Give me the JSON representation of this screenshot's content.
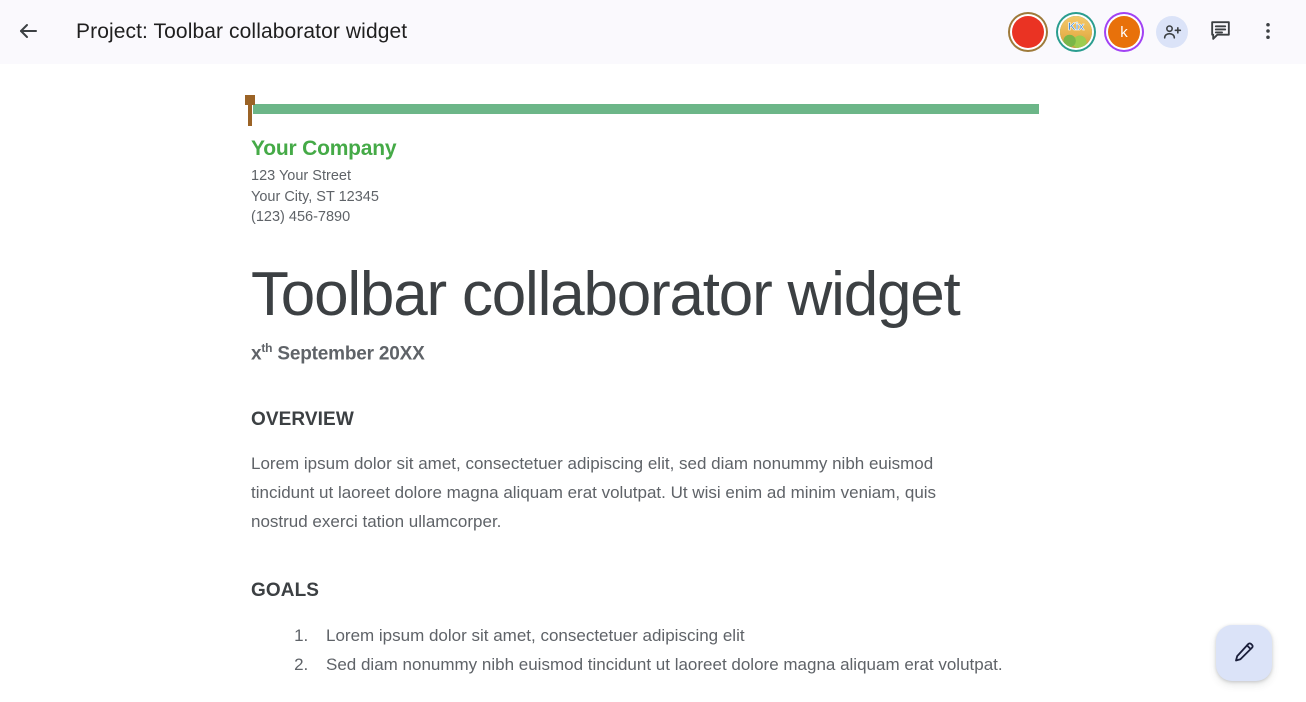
{
  "appbar": {
    "back_icon": "arrow-left-icon",
    "title": "Project: Toolbar collaborator widget",
    "collaborators": [
      {
        "name": "collaborator-red",
        "initial": "",
        "fill": "#ea3323",
        "ring": "#9e7a3a",
        "kind": "solid"
      },
      {
        "name": "collaborator-kix",
        "initial": "Kix",
        "fill": "#e8b44f",
        "ring": "#2a9d8f",
        "kind": "photo"
      },
      {
        "name": "collaborator-k",
        "initial": "k",
        "fill": "#e8710a",
        "ring": "#a142f4",
        "kind": "initial"
      }
    ],
    "add_person_icon": "add-person-icon",
    "comment_icon": "comment-icon",
    "more_icon": "more-vertical-icon"
  },
  "document": {
    "company": "Your Company",
    "address_line_1": "123 Your Street",
    "address_line_2": "Your City, ST 12345",
    "address_line_3": "(123) 456-7890",
    "title": "Toolbar collaborator widget",
    "date_prefix": "x",
    "date_suffix": "th",
    "date_rest": " September 20XX",
    "overview_heading": "OVERVIEW",
    "overview_body": "Lorem ipsum dolor sit amet, consectetuer adipiscing elit, sed diam nonummy nibh euismod tincidunt ut laoreet dolore magna aliquam erat volutpat. Ut wisi enim ad minim veniam, quis nostrud exerci tation ullamcorper.",
    "goals_heading": "GOALS",
    "goals": [
      "Lorem ipsum dolor sit amet, consectetuer adipiscing elit",
      "Sed diam nonummy nibh euismod tincidunt ut laoreet dolore magna aliquam erat volutpat."
    ],
    "rule_color": "#6cb688",
    "company_color": "#45aa47",
    "caret_color": "#9b6326"
  },
  "fab": {
    "icon": "pencil-icon",
    "background": "#dbe3f8"
  }
}
